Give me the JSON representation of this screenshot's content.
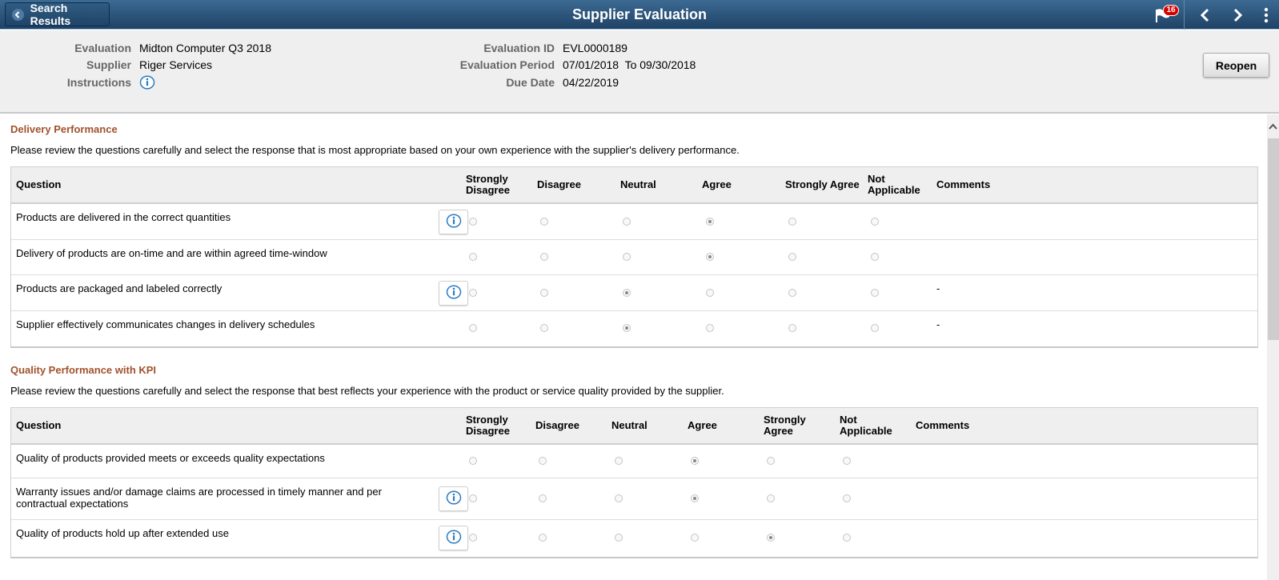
{
  "banner": {
    "back_label": "Search Results",
    "title": "Supplier Evaluation",
    "notification_count": "16",
    "icons": [
      "chevron-left-icon",
      "flag-icon",
      "previous-icon",
      "next-icon",
      "kebab-menu-icon"
    ]
  },
  "header": {
    "evaluation_label": "Evaluation",
    "evaluation_value": "Midton Computer Q3 2018",
    "supplier_label": "Supplier",
    "supplier_value": "Riger Services",
    "instructions_label": "Instructions",
    "evaluation_id_label": "Evaluation ID",
    "evaluation_id_value": "EVL0000189",
    "evaluation_period_label": "Evaluation Period",
    "evaluation_period_value": "07/01/2018  To 09/30/2018",
    "due_date_label": "Due Date",
    "due_date_value": "04/22/2019",
    "reopen_label": "Reopen"
  },
  "sections": [
    {
      "title": "Delivery Performance",
      "description": "Please review the questions carefully and select the response that is most appropriate based on your own experience with the supplier's delivery performance.",
      "columns": {
        "question": "Question",
        "strongly_disagree": [
          "Strongly",
          "Disagree"
        ],
        "disagree": "Disagree",
        "neutral": "Neutral",
        "agree": "Agree",
        "strongly_agree": "Strongly Agree",
        "not_applicable": [
          "Not",
          "Applicable"
        ],
        "comments": "Comments"
      },
      "rows": [
        {
          "question": "Products are delivered in the correct quantities",
          "has_info": true,
          "selected": "Agree",
          "comment": ""
        },
        {
          "question": "Delivery of products are on-time and are within agreed time-window",
          "has_info": false,
          "selected": "Agree",
          "comment": ""
        },
        {
          "question": "Products are packaged and labeled correctly",
          "has_info": true,
          "selected": "Neutral",
          "comment": "-"
        },
        {
          "question": "Supplier effectively  communicates changes in delivery schedules",
          "has_info": false,
          "selected": "Neutral",
          "comment": "-"
        }
      ]
    },
    {
      "title": "Quality Performance with KPI",
      "description": "Please review the questions carefully and select the response that best reflects your experience with the product or service quality provided by the supplier.",
      "columns": {
        "question": "Question",
        "strongly_disagree": [
          "Strongly",
          "Disagree"
        ],
        "disagree": "Disagree",
        "neutral": "Neutral",
        "agree": "Agree",
        "strongly_agree": [
          "Strongly",
          "Agree"
        ],
        "not_applicable": [
          "Not",
          "Applicable"
        ],
        "comments": "Comments"
      },
      "rows": [
        {
          "question": "Quality of products provided meets or exceeds quality expectations",
          "has_info": false,
          "selected": "Agree",
          "comment": ""
        },
        {
          "question": "Warranty issues and/or damage claims are processed in timely manner and per contractual expectations",
          "has_info": true,
          "selected": "Agree",
          "comment": ""
        },
        {
          "question": "Quality of products hold up after extended use",
          "has_info": true,
          "selected": "Strongly Agree",
          "comment": ""
        }
      ]
    }
  ],
  "response_options": [
    "Strongly Disagree",
    "Disagree",
    "Neutral",
    "Agree",
    "Strongly Agree",
    "Not Applicable"
  ]
}
